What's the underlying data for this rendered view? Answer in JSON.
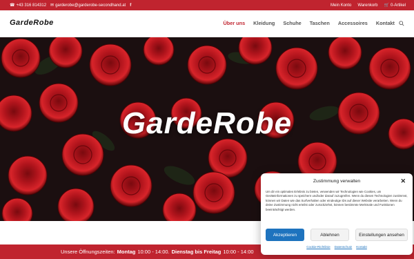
{
  "topbar": {
    "phone": "+43 316 814312",
    "email": "garderobe@garderobe-secondhand.at",
    "facebook_icon": "facebook-icon",
    "account": "Mein Konto",
    "cart": "Warenkorb",
    "cart_count": "0-Artikel",
    "bg_color": "#c0242f"
  },
  "header": {
    "logo": "GardeRobe",
    "nav": [
      "Über uns",
      "Kleidung",
      "Schuhe",
      "Taschen",
      "Accessoires",
      "Kontakt"
    ],
    "active_nav": "Über uns"
  },
  "hero": {
    "title": "GardeRobe"
  },
  "hours": {
    "prefix": "Unsere Öffnungszeiten:",
    "day1": "Montag",
    "time1": "10:00 - 14:00.",
    "day2": "Dienstag bis Freitag",
    "time2": "10:00 - 14:00"
  },
  "cookie": {
    "title": "Zustimmung verwalten",
    "text": "Um dir ein optimales Erlebnis zu bieten, verwenden wir Technologien wie Cookies, um Geräteinformationen zu speichern und/oder darauf zuzugreifen. Wenn du diesen Technologien zustimmst, können wir Daten wie das Surfverhalten oder eindeutige IDs auf dieser Website verarbeiten. Wenn du deine Zustimmung nicht erteilst oder zurückziehst, können bestimmte Merkmale und Funktionen beeinträchtigt werden.",
    "accept": "Akzeptieren",
    "decline": "Ablehnen",
    "settings": "Einstellungen ansehen",
    "links": [
      "Cookie-Richtlinie",
      "Datenschutz",
      "Kontakt"
    ],
    "accent": "#1e73be"
  }
}
